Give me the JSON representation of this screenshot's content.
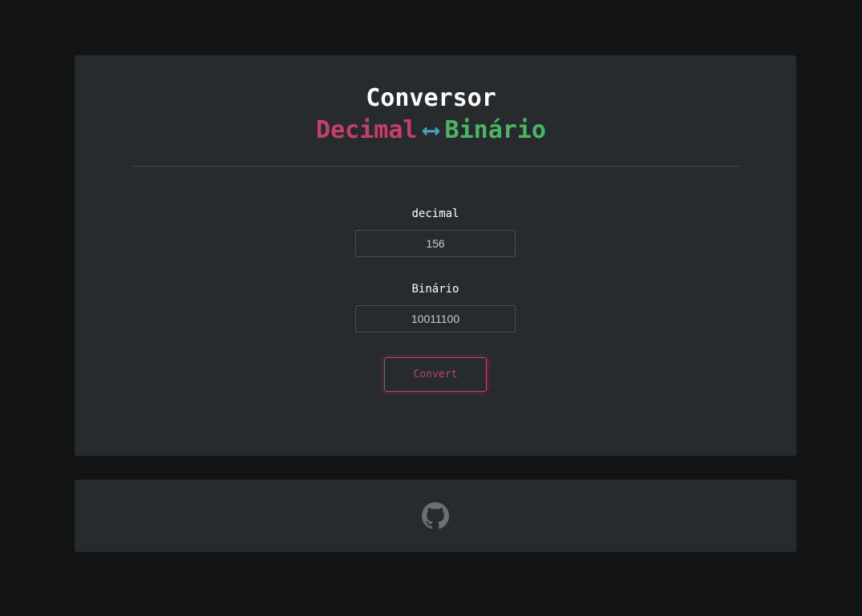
{
  "header": {
    "title": "Conversor",
    "subtitle_left": "Decimal",
    "subtitle_arrow": "⟷",
    "subtitle_right": "Binário"
  },
  "form": {
    "decimal_label": "decimal",
    "decimal_value": "156",
    "binario_label": "Binário",
    "binario_value": "10011100",
    "convert_label": "Convert"
  },
  "footer": {
    "icon": "github-icon"
  },
  "colors": {
    "background": "#131416",
    "card": "#272b2d",
    "decimal_accent": "#c2416a",
    "arrow_accent": "#45a3bd",
    "binario_accent": "#49b565",
    "icon": "#6b6f72"
  }
}
